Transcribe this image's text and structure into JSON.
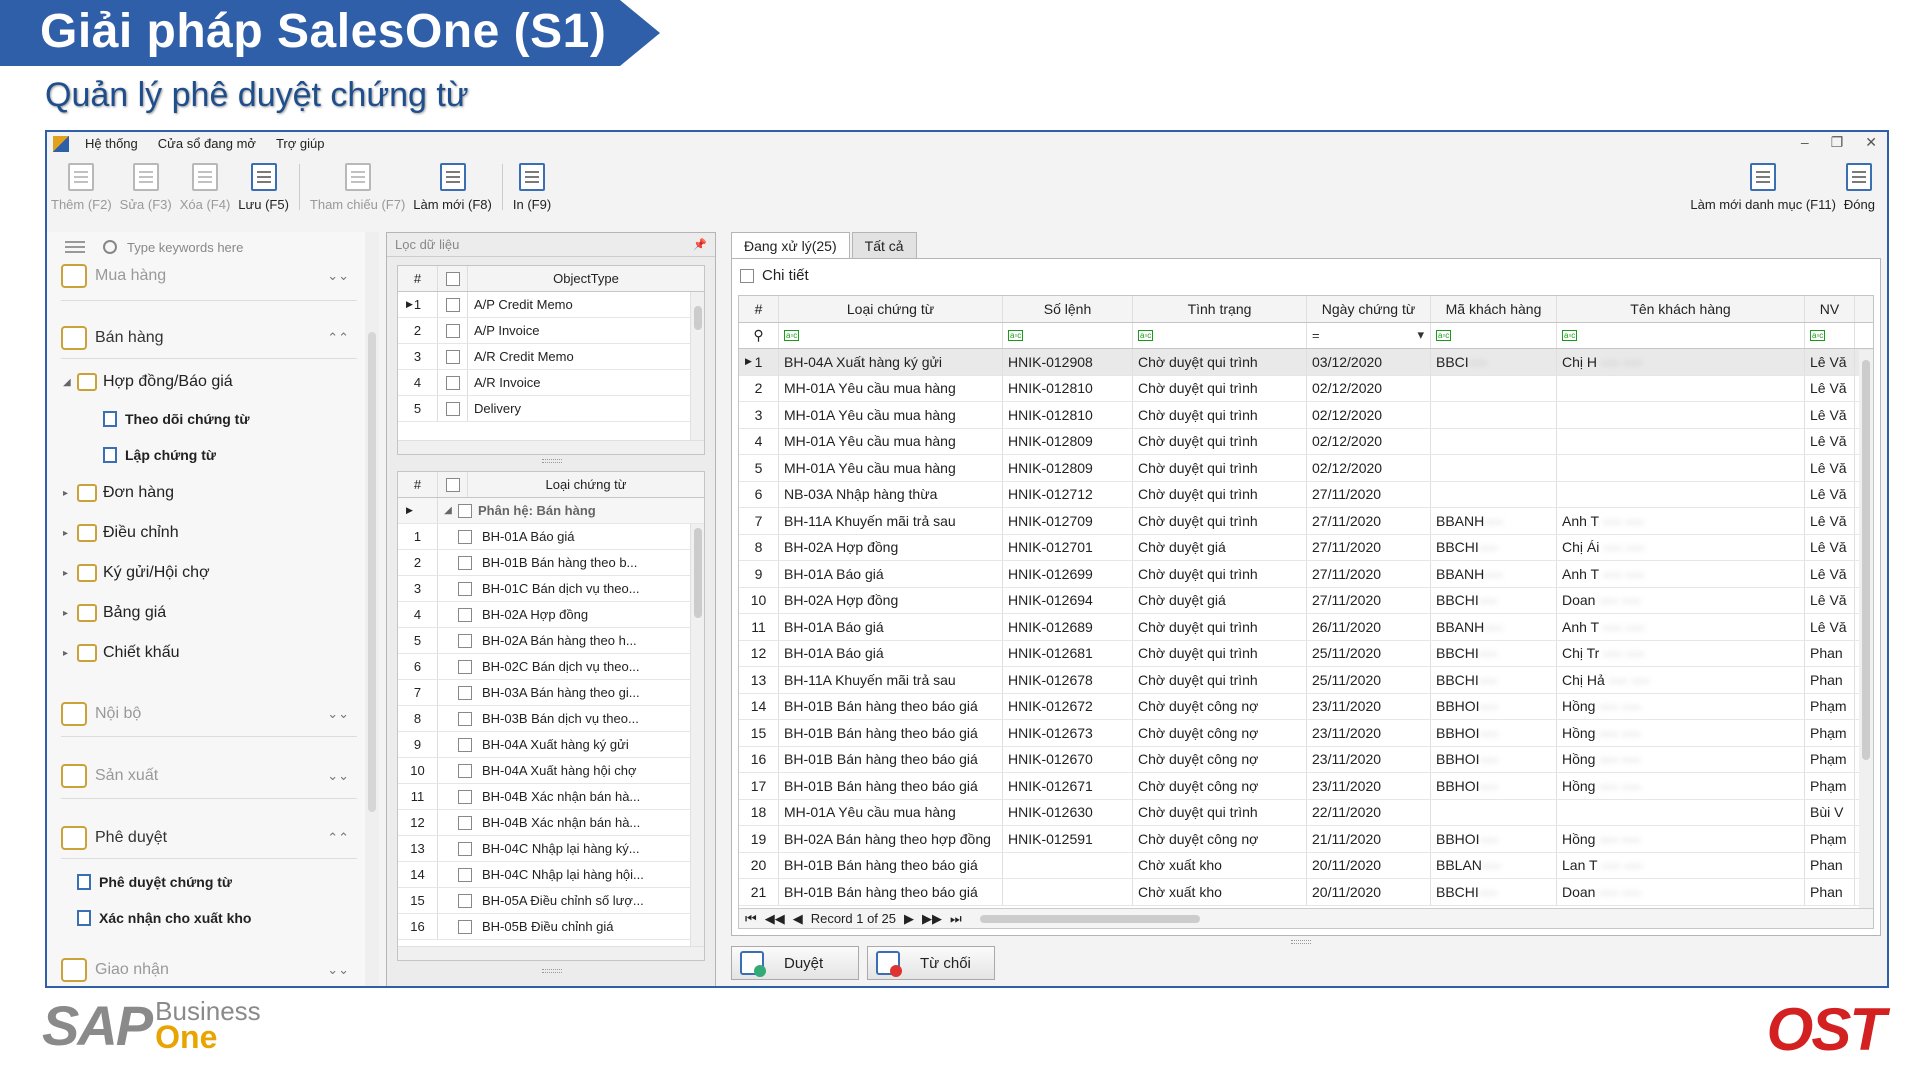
{
  "slide": {
    "title": "Giải pháp SalesOne (S1)",
    "subtitle": "Quản lý phê duyệt chứng từ"
  },
  "menu": [
    "Hệ thống",
    "Cửa sổ đang mở",
    "Trợ giúp"
  ],
  "toolbar": {
    "add": "Thêm (F2)",
    "edit": "Sửa (F3)",
    "delete": "Xóa (F4)",
    "save": "Lưu (F5)",
    "reference": "Tham chiếu (F7)",
    "refresh": "Làm mới (F8)",
    "print": "In (F9)",
    "refresh_catalog": "Làm mới danh mục (F11)",
    "close": "Đóng"
  },
  "nav": {
    "search_placeholder": "Type keywords here",
    "groups": {
      "purchasing": "Mua hàng",
      "sales": "Bán hàng",
      "internal": "Nội bộ",
      "production": "Sản xuất",
      "approval": "Phê duyệt",
      "receiving": "Giao nhận"
    },
    "sales_nodes": {
      "contract": "Hợp đồng/Báo giá",
      "track": "Theo dõi chứng từ",
      "create": "Lập chứng từ",
      "order": "Đơn hàng",
      "adjust": "Điều chỉnh",
      "consign": "Ký gửi/Hội chợ",
      "price": "Bảng giá",
      "discount": "Chiết khấu"
    },
    "approval_nodes": {
      "approve_docs": "Phê duyệt chứng từ",
      "confirm_issue": "Xác nhận cho xuất kho"
    }
  },
  "filter": {
    "title": "Lọc dữ liệu",
    "object_grid": {
      "headers": [
        "#",
        "ObjectType"
      ],
      "rows": [
        {
          "n": "1",
          "t": "A/P Credit Memo"
        },
        {
          "n": "2",
          "t": "A/P Invoice"
        },
        {
          "n": "3",
          "t": "A/R Credit Memo"
        },
        {
          "n": "4",
          "t": "A/R Invoice"
        },
        {
          "n": "5",
          "t": "Delivery"
        }
      ]
    },
    "doctype_grid": {
      "headers": [
        "#",
        "Loại chứng từ"
      ],
      "group_row": "Phân hệ: Bán hàng",
      "rows": [
        {
          "n": "1",
          "t": "BH-01A Báo giá"
        },
        {
          "n": "2",
          "t": "BH-01B Bán hàng theo b..."
        },
        {
          "n": "3",
          "t": "BH-01C Bán dịch vụ theo..."
        },
        {
          "n": "4",
          "t": "BH-02A Hợp đồng"
        },
        {
          "n": "5",
          "t": "BH-02A Bán hàng theo h..."
        },
        {
          "n": "6",
          "t": "BH-02C Bán dịch vụ theo..."
        },
        {
          "n": "7",
          "t": "BH-03A Bán hàng theo gi..."
        },
        {
          "n": "8",
          "t": "BH-03B Bán dịch vụ theo..."
        },
        {
          "n": "9",
          "t": "BH-04A Xuất hàng ký gửi"
        },
        {
          "n": "10",
          "t": "BH-04A Xuất hàng hội chợ"
        },
        {
          "n": "11",
          "t": "BH-04B Xác nhận bán hà..."
        },
        {
          "n": "12",
          "t": "BH-04B Xác nhận bán hà..."
        },
        {
          "n": "13",
          "t": "BH-04C Nhập lại hàng ký..."
        },
        {
          "n": "14",
          "t": "BH-04C Nhập lại hàng hội..."
        },
        {
          "n": "15",
          "t": "BH-05A Điều chỉnh số lượ..."
        },
        {
          "n": "16",
          "t": "BH-05B Điều chỉnh giá"
        }
      ]
    }
  },
  "tabs": [
    "Đang xử lý(25)",
    "Tất cả"
  ],
  "detail_label": "Chi tiết",
  "grid": {
    "headers": [
      "#",
      "Loại chứng từ",
      "Số lệnh",
      "Tình trạng",
      "Ngày chứng từ",
      "Mã khách hàng",
      "Tên khách hàng",
      "NV"
    ],
    "filter_ops": [
      "=",
      "▾"
    ],
    "rows": [
      [
        "1",
        "BH-04A Xuất hàng ký gửi",
        "HNIK-012908",
        "Chờ duyệt qui trình",
        "03/12/2020",
        "BBCI",
        "Chị H",
        "Lê Vă"
      ],
      [
        "2",
        "MH-01A Yêu cầu mua hàng",
        "HNIK-012810",
        "Chờ duyệt qui trình",
        "02/12/2020",
        "",
        "",
        "Lê Vă"
      ],
      [
        "3",
        "MH-01A Yêu cầu mua hàng",
        "HNIK-012810",
        "Chờ duyệt qui trình",
        "02/12/2020",
        "",
        "",
        "Lê Vă"
      ],
      [
        "4",
        "MH-01A Yêu cầu mua hàng",
        "HNIK-012809",
        "Chờ duyệt qui trình",
        "02/12/2020",
        "",
        "",
        "Lê Vă"
      ],
      [
        "5",
        "MH-01A Yêu cầu mua hàng",
        "HNIK-012809",
        "Chờ duyệt qui trình",
        "02/12/2020",
        "",
        "",
        "Lê Vă"
      ],
      [
        "6",
        "NB-03A Nhập hàng thừa",
        "HNIK-012712",
        "Chờ duyệt qui trình",
        "27/11/2020",
        "",
        "",
        "Lê Vă"
      ],
      [
        "7",
        "BH-11A Khuyến mãi trả sau",
        "HNIK-012709",
        "Chờ duyệt qui trình",
        "27/11/2020",
        "BBANH",
        "Anh T",
        "Lê Vă"
      ],
      [
        "8",
        "BH-02A Hợp đồng",
        "HNIK-012701",
        "Chờ duyệt giá",
        "27/11/2020",
        "BBCHI",
        "Chị Ái",
        "Lê Vă"
      ],
      [
        "9",
        "BH-01A Báo giá",
        "HNIK-012699",
        "Chờ duyệt qui trình",
        "27/11/2020",
        "BBANH",
        "Anh T",
        "Lê Vă"
      ],
      [
        "10",
        "BH-02A Hợp đồng",
        "HNIK-012694",
        "Chờ duyệt giá",
        "27/11/2020",
        "BBCHI",
        "Doan",
        "Lê Vă"
      ],
      [
        "11",
        "BH-01A Báo giá",
        "HNIK-012689",
        "Chờ duyệt qui trình",
        "26/11/2020",
        "BBANH",
        "Anh T",
        "Lê Vă"
      ],
      [
        "12",
        "BH-01A Báo giá",
        "HNIK-012681",
        "Chờ duyệt qui trình",
        "25/11/2020",
        "BBCHI",
        "Chị Tr",
        "Phan"
      ],
      [
        "13",
        "BH-11A Khuyến mãi trả sau",
        "HNIK-012678",
        "Chờ duyệt qui trình",
        "25/11/2020",
        "BBCHI",
        "Chị Hả",
        "Phan"
      ],
      [
        "14",
        "BH-01B Bán hàng theo báo giá",
        "HNIK-012672",
        "Chờ duyệt công nợ",
        "23/11/2020",
        "BBHOI",
        "Hồng",
        "Phạm"
      ],
      [
        "15",
        "BH-01B Bán hàng theo báo giá",
        "HNIK-012673",
        "Chờ duyệt công nợ",
        "23/11/2020",
        "BBHOI",
        "Hồng",
        "Phạm"
      ],
      [
        "16",
        "BH-01B Bán hàng theo báo giá",
        "HNIK-012670",
        "Chờ duyệt công nợ",
        "23/11/2020",
        "BBHOI",
        "Hồng",
        "Phạm"
      ],
      [
        "17",
        "BH-01B Bán hàng theo báo giá",
        "HNIK-012671",
        "Chờ duyệt công nợ",
        "23/11/2020",
        "BBHOI",
        "Hồng",
        "Phạm"
      ],
      [
        "18",
        "MH-01A Yêu cầu mua hàng",
        "HNIK-012630",
        "Chờ duyệt qui trình",
        "22/11/2020",
        "",
        "",
        "Bùi V"
      ],
      [
        "19",
        "BH-02A Bán hàng theo hợp đồng",
        "HNIK-012591",
        "Chờ duyệt công nợ",
        "21/11/2020",
        "BBHOI",
        "Hồng",
        "Phạm"
      ],
      [
        "20",
        "BH-01B Bán hàng theo báo giá",
        "",
        "Chờ xuất kho",
        "20/11/2020",
        "BBLAN",
        "Lan T",
        "Phan"
      ],
      [
        "21",
        "BH-01B Bán hàng theo báo giá",
        "",
        "Chờ xuất kho",
        "20/11/2020",
        "BBCHI",
        "Doan",
        "Phan"
      ]
    ],
    "pager": "Record 1 of 25"
  },
  "actions": {
    "approve": "Duyệt",
    "reject": "Từ chối"
  },
  "logos": {
    "sap": "SAP",
    "sap_line1": "Business",
    "sap_line2": "One",
    "ost": "OST"
  }
}
